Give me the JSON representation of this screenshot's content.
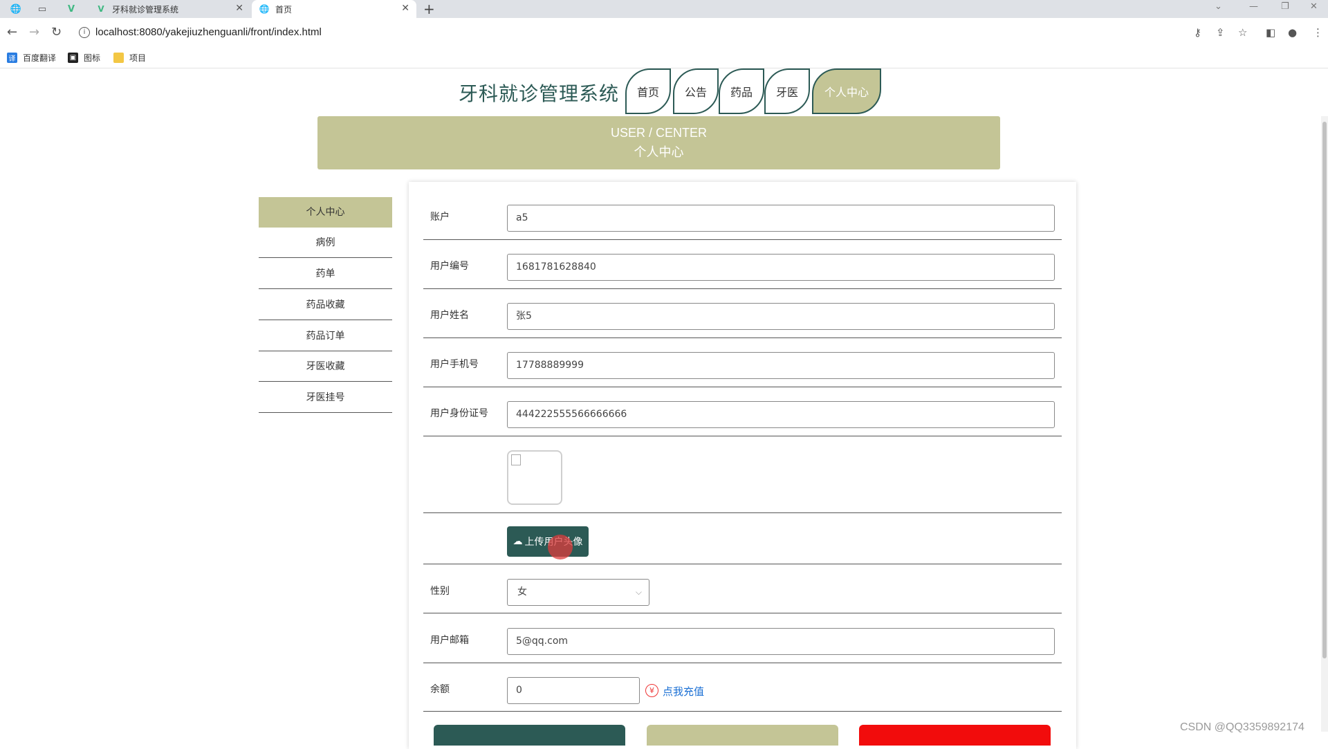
{
  "browser": {
    "tabs": [
      {
        "title": "牙科就诊管理系统",
        "icon": "vue-logo-icon"
      },
      {
        "title": "首页",
        "icon": "globe-icon"
      }
    ],
    "url": "localhost:8080/yakejiuzhenguanli/front/index.html",
    "bookmarks": [
      "百度翻译",
      "图标",
      "项目"
    ]
  },
  "site": {
    "title": "牙科就诊管理系统",
    "nav": [
      "首页",
      "公告",
      "药品",
      "牙医",
      "个人中心"
    ],
    "active_nav": "个人中心"
  },
  "banner": {
    "en": "USER / CENTER",
    "cn": "个人中心"
  },
  "sidebar": {
    "items": [
      "个人中心",
      "病例",
      "药单",
      "药品收藏",
      "药品订单",
      "牙医收藏",
      "牙医挂号"
    ],
    "active": "个人中心"
  },
  "form": {
    "account_label": "账户",
    "account_value": "a5",
    "userno_label": "用户编号",
    "userno_value": "1681781628840",
    "name_label": "用户姓名",
    "name_value": "张5",
    "phone_label": "用户手机号",
    "phone_value": "17788889999",
    "idcard_label": "用户身份证号",
    "idcard_value": "444222555566666666",
    "upload_label": "上传用户头像",
    "gender_label": "性别",
    "gender_value": "女",
    "email_label": "用户邮箱",
    "email_value": "5@qq.com",
    "balance_label": "余额",
    "balance_value": "0",
    "recharge_label": "点我充值"
  },
  "colors": {
    "primary": "#2c5a55",
    "accent": "#c4c596",
    "danger": "#f20c0c",
    "link": "#1a6fd4"
  },
  "watermark": "CSDN @QQ3359892174"
}
